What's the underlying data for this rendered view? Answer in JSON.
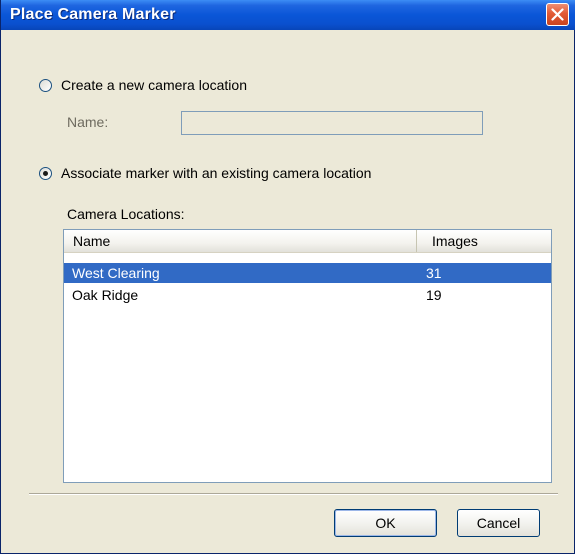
{
  "window": {
    "title": "Place Camera Marker"
  },
  "options": {
    "create_new": {
      "label": "Create a new camera location",
      "selected": false
    },
    "name_label": "Name:",
    "name_value": "",
    "associate": {
      "label": "Associate marker with an existing camera location",
      "selected": true
    }
  },
  "list": {
    "caption": "Camera Locations:",
    "columns": [
      "Name",
      "Images"
    ],
    "rows": [
      {
        "name": "West Clearing",
        "images": "31",
        "selected": true
      },
      {
        "name": "Oak Ridge",
        "images": "19",
        "selected": false
      }
    ]
  },
  "buttons": {
    "ok": "OK",
    "cancel": "Cancel"
  },
  "colors": {
    "title_bar": "#0a56d8",
    "selection": "#316ac5",
    "close_button": "#e25a35"
  }
}
